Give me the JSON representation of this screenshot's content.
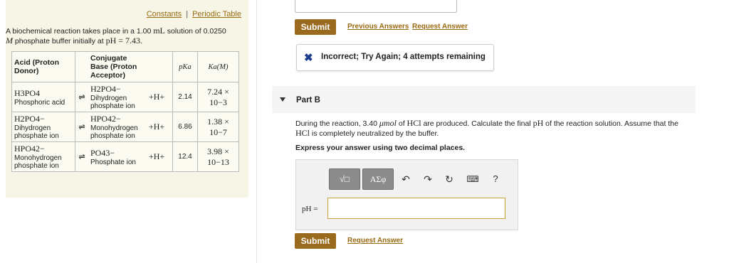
{
  "links": {
    "constants": "Constants",
    "periodic_table": "Periodic Table",
    "separator": "|"
  },
  "problem": {
    "line1_a": "A biochemical reaction takes place in a 1.00 ",
    "line1_unit": "mL",
    "line1_b": " solution of 0.0250",
    "line2_a": "M",
    "line2_b": " phosphate buffer initially at ",
    "line2_ph": "pH = 7.43."
  },
  "table": {
    "headers": {
      "acid": "Acid (Proton Donor)",
      "base": "Conjugate Base (Proton Acceptor)",
      "pka": "pKa",
      "ka": "Ka(M)"
    },
    "rows": [
      {
        "acid_formula": "H3PO4",
        "acid_name": "Phosphoric acid",
        "arrow": "⇌",
        "base_formula": "H2PO4−",
        "base_name": "Dihydrogen phosphate ion",
        "hplus": "+H+",
        "pka": "2.14",
        "ka": "7.24 × 10−3"
      },
      {
        "acid_formula": "H2PO4−",
        "acid_name": "Dihydrogen phosphate ion",
        "arrow": "⇌",
        "base_formula": "HPO42−",
        "base_name": "Monohydrogen phosphate ion",
        "hplus": "+H+",
        "pka": "6.86",
        "ka": "1.38 × 10−7"
      },
      {
        "acid_formula": "HPO42−",
        "acid_name": "Monohydrogen phosphate ion",
        "arrow": "⇌",
        "base_formula": "PO43−",
        "base_name": "Phosphate ion",
        "hplus": "+H+",
        "pka": "12.4",
        "ka": "3.98 × 10−13"
      }
    ]
  },
  "partA": {
    "submit": "Submit",
    "previous_answers": "Previous Answers",
    "request_answer": "Request Answer",
    "feedback_icon": "x-icon",
    "feedback_text": "Incorrect; Try Again; 4 attempts remaining"
  },
  "partB": {
    "title": "Part B",
    "question_a": "During the reaction, 3.40 ",
    "question_unit": "μmol",
    "question_b": " of ",
    "question_hcl": "HCl",
    "question_c": " are produced. Calculate the final ",
    "question_ph": "pH",
    "question_d": " of the reaction solution. Assume that the",
    "question_line2_hcl": "HCl",
    "question_line2": " is completely neutralized by the buffer.",
    "express": "Express your answer using two decimal places.",
    "toolbar": {
      "template": "√□",
      "symbols": "ΑΣφ",
      "help": "?"
    },
    "ph_label": "pH =",
    "ph_value": "",
    "submit": "Submit",
    "request_answer": "Request Answer"
  },
  "colors": {
    "accent": "#9a6a1e",
    "link": "#9a6a12",
    "incorrect": "#1e3d8f",
    "left_bg": "#f7f6e6"
  }
}
